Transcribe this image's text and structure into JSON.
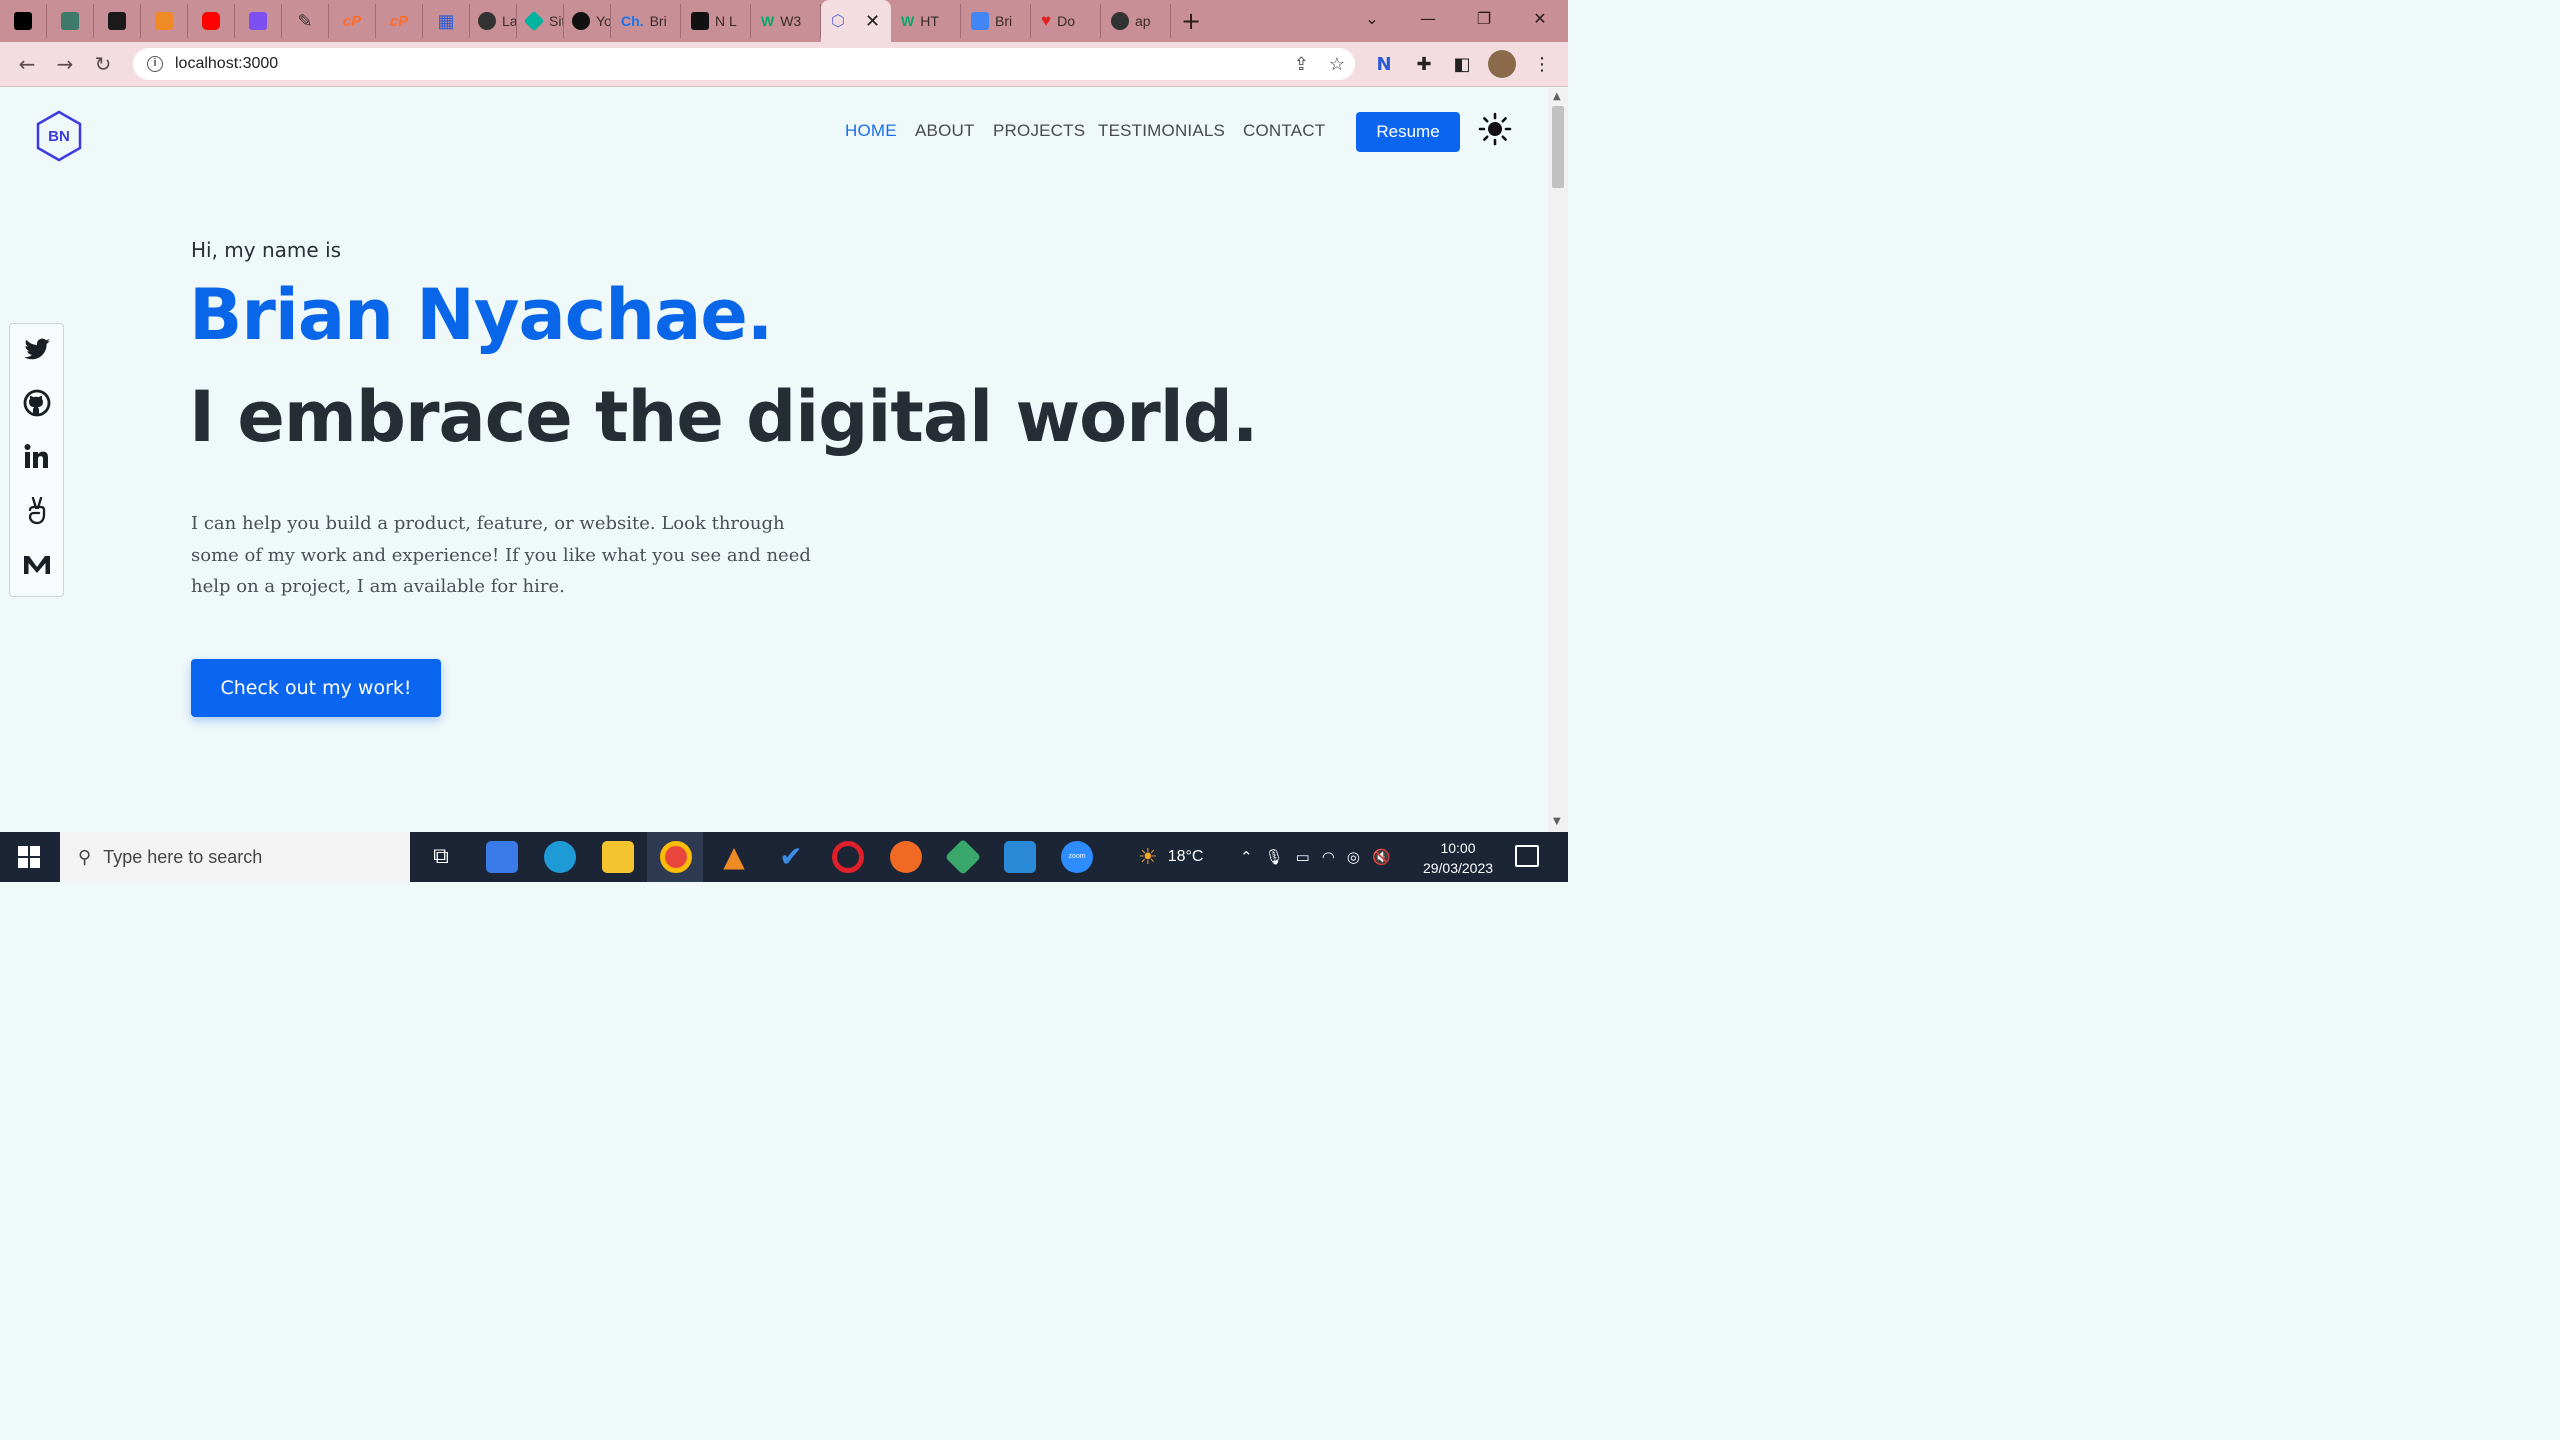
{
  "browser": {
    "tabs": [
      {
        "label": "",
        "icon": "medium-icon",
        "color": "#000000"
      },
      {
        "label": "",
        "icon": "map-pin-icon",
        "color": "#3d7a6a"
      },
      {
        "label": "",
        "icon": "trello-icon",
        "color": "#1a1a1a"
      },
      {
        "label": "",
        "icon": "triangle-icon",
        "color": "#f08a24"
      },
      {
        "label": "",
        "icon": "youtube-icon",
        "color": "#ff0000"
      },
      {
        "label": "",
        "icon": "ink-icon",
        "color": "#7b4ff0"
      },
      {
        "label": "",
        "icon": "feather-icon",
        "color": "#444444"
      },
      {
        "label": "",
        "icon": "cpanel-icon",
        "color": "#ff6c2c"
      },
      {
        "label": "",
        "icon": "cpanel-icon",
        "color": "#ff6c2c"
      },
      {
        "label": "",
        "icon": "grid-icon",
        "color": "#2a5bd7"
      },
      {
        "label": "Lau",
        "icon": "globe-icon",
        "color": "#333333"
      },
      {
        "label": "Site",
        "icon": "diamond-icon",
        "color": "#00b39f"
      },
      {
        "label": "You",
        "icon": "github-icon",
        "color": "#111111"
      },
      {
        "label": "Bri",
        "icon": "ch-icon",
        "color": "#1a73e8"
      },
      {
        "label": "N L",
        "icon": "codepen-icon",
        "color": "#111111"
      },
      {
        "label": "W3",
        "icon": "w3-icon",
        "color": "#04aa6d"
      },
      {
        "label": "",
        "icon": "hexagon-icon",
        "color": "#6b6bd6"
      },
      {
        "label": "HT",
        "icon": "w3-icon",
        "color": "#04aa6d"
      },
      {
        "label": "Bri",
        "icon": "docs-icon",
        "color": "#4285f4"
      },
      {
        "label": "Do",
        "icon": "heart-icon",
        "color": "#e02424"
      },
      {
        "label": "ap",
        "icon": "globe-icon",
        "color": "#333333"
      }
    ],
    "url": "localhost:3000"
  },
  "site": {
    "logo_text": "BN",
    "nav": [
      "HOME",
      "ABOUT",
      "PROJECTS",
      "TESTIMONIALS",
      "CONTACT"
    ],
    "resume_label": "Resume",
    "intro": "Hi, my name is",
    "name": "Brian Nyachae.",
    "tagline": "I embrace the digital world.",
    "description": "I can help you build a product, feature, or website. Look through some of my work and experience! If you like what you see and need help on a project, I am available for hire.",
    "cta_label": "Check out my work!",
    "social": [
      "twitter-icon",
      "github-icon",
      "linkedin-icon",
      "angellist-icon",
      "medium-icon"
    ],
    "colors": {
      "accent": "#0a66f0",
      "heading": "#262d35",
      "background": "#f0f9f9"
    }
  },
  "taskbar": {
    "search_placeholder": "Type here to search",
    "weather": "18°C",
    "time": "10:00",
    "date": "29/03/2023"
  }
}
